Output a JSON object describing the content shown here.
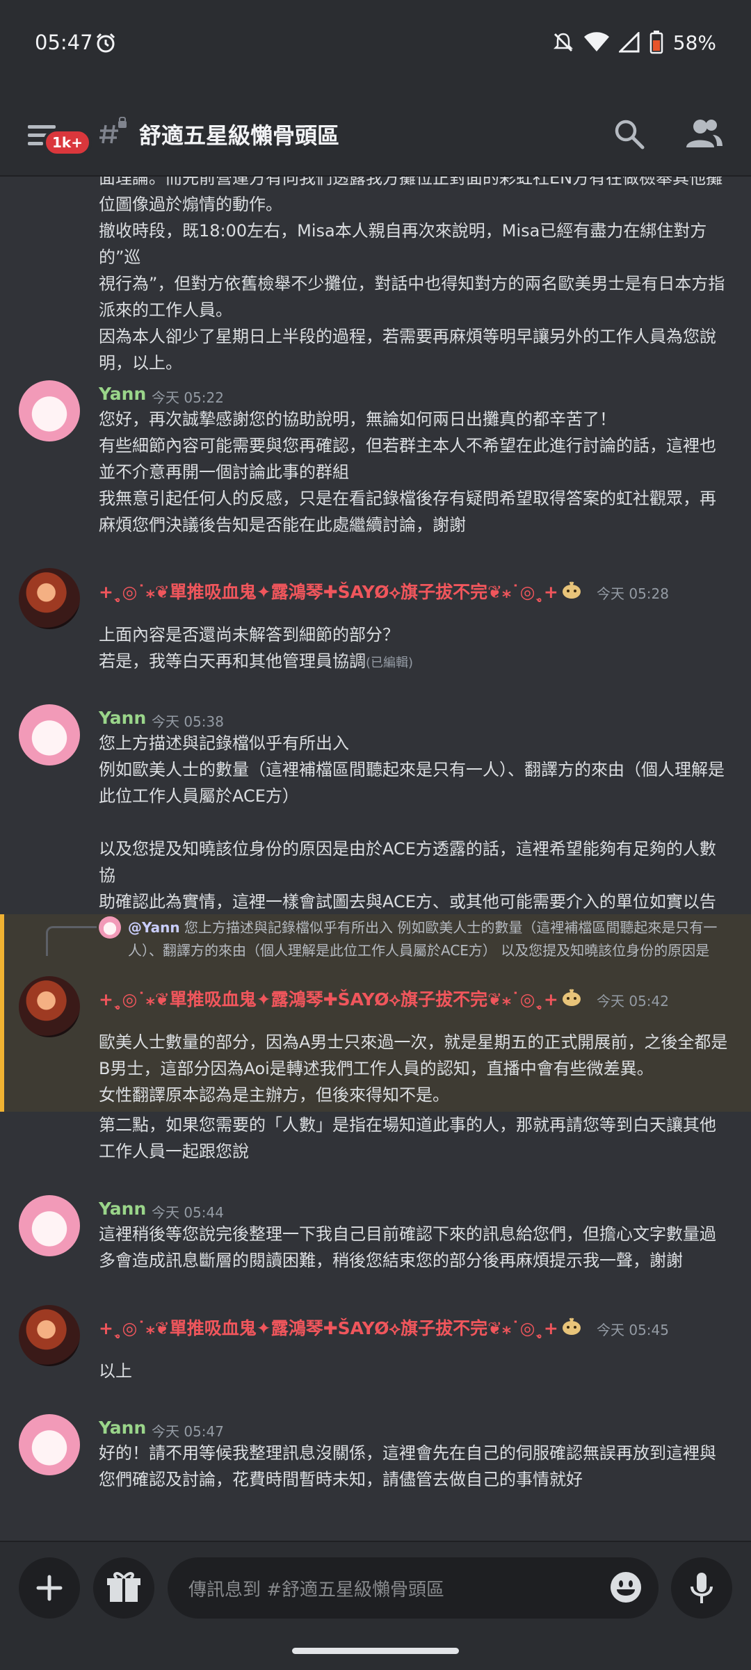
{
  "status_bar": {
    "time": "05:47",
    "battery": "58%"
  },
  "header": {
    "badge": "1k+",
    "channel_name": "舒適五星級懶骨頭區"
  },
  "top_partial": {
    "lines": [
      "面理論。而先前營運方有向我們透露我方攤位正對面的彩虹社EN方有在做檢舉其他攤",
      "位圖像過於煽情的動作。",
      "撤收時段，既18:00左右，Misa本人親自再次來說明，Misa已經有盡力在綁住對方的”巡",
      "視行為”，但對方依舊檢舉不少攤位，對話中也得知對方的兩名歐美男士是有日本方指",
      "派來的工作人員。",
      "因為本人卻少了星期日上半段的過程，若需要再麻煩等明早讓另外的工作人員為您說",
      "明，以上。"
    ]
  },
  "messages": {
    "m1": {
      "author": "Yann",
      "timestamp": "今天 05:22",
      "lines": [
        "您好，再次誠摯感謝您的協助說明，無論如何兩日出攤真的都辛苦了！",
        "有些細節內容可能需要與您再確認，但若群主本人不希望在此進行討論的話，這裡也",
        "並不介意再開一個討論此事的群組",
        "我無意引起任何人的反感，只是在看記錄檔後存有疑問希望取得答案的虹社觀眾，再",
        "麻煩您們決議後告知是否能在此處繼續討論，謝謝"
      ]
    },
    "m2": {
      "author": "+ˎ̥◎˙⁎❦單推吸血鬼✦露鴻琴✚ŠAYØ⟡旗子拔不完❦⁎˙◎ˎ̥+",
      "timestamp": "今天 05:28",
      "lines": [
        "上面內容是否還尚未解答到細節的部分？",
        "若是，我等白天再和其他管理員協調"
      ],
      "edited": "(已編輯)"
    },
    "m3": {
      "author": "Yann",
      "timestamp": "今天 05:38",
      "lines": [
        "您上方描述與記錄檔似乎有所出入",
        "例如歐美人士的數量（這裡補檔區間聽起來是只有一人）、翻譯方的來由（個人理解是",
        "此位工作人員屬於ACE方）",
        "",
        "以及您提及知曉該位身份的原因是由於ACE方透露的話，這裡希望能夠有足夠的人數協",
        "助確認此為實情，這裡一樣會試圖去與ACE方、或其他可能需要介入的單位如實以告"
      ]
    },
    "m4": {
      "reply_name": "@Yann",
      "reply_text": "您上方描述與記錄檔似乎有所出入 例如歐美人士的數量（這裡補檔區間聽起來是只有一人）、翻譯方的來由（個人理解是此位工作人員屬於ACE方） 以及您提及知曉該位身份的原因是",
      "author": "+ˎ̥◎˙⁎❦單推吸血鬼✦露鴻琴✚ŠAYØ⟡旗子拔不完❦⁎˙◎ˎ̥+",
      "timestamp": "今天 05:42",
      "lines": [
        "歐美人士數量的部分，因為A男士只來過一次，就是星期五的正式開展前，之後全都是",
        "B男士，這部分因為Aoi是轉述我們工作人員的認知，直播中會有些微差異。",
        "女性翻譯原本認為是主辦方，但後來得知不是。"
      ],
      "followup_lines": [
        "第二點，如果您需要的「人數」是指在場知道此事的人，那就再請您等到白天讓其他",
        "工作人員一起跟您說"
      ]
    },
    "m5": {
      "author": "Yann",
      "timestamp": "今天 05:44",
      "lines": [
        "這裡稍後等您說完後整理一下我自己目前確認下來的訊息給您們，但擔心文字數量過",
        "多會造成訊息斷層的閱讀困難，稍後您結束您的部分後再麻煩提示我一聲，謝謝"
      ]
    },
    "m6": {
      "author": "+ˎ̥◎˙⁎❦單推吸血鬼✦露鴻琴✚ŠAYØ⟡旗子拔不完❦⁎˙◎ˎ̥+",
      "timestamp": "今天 05:45",
      "lines": [
        "以上"
      ]
    },
    "m7": {
      "author": "Yann",
      "timestamp": "今天 05:47",
      "lines": [
        "好的！請不用等候我整理訊息沒關係，這裡會先在自己的伺服確認無誤再放到這裡與",
        "您們確認及討論，花費時間暫時未知，請儘管去做自己的事情就好"
      ]
    }
  },
  "composer": {
    "placeholder": "傳訊息到 #舒適五星級懶骨頭區"
  },
  "colors": {
    "yann": "#9ad58a",
    "vamp": "#f0565c",
    "highlight": "#f0b232"
  }
}
